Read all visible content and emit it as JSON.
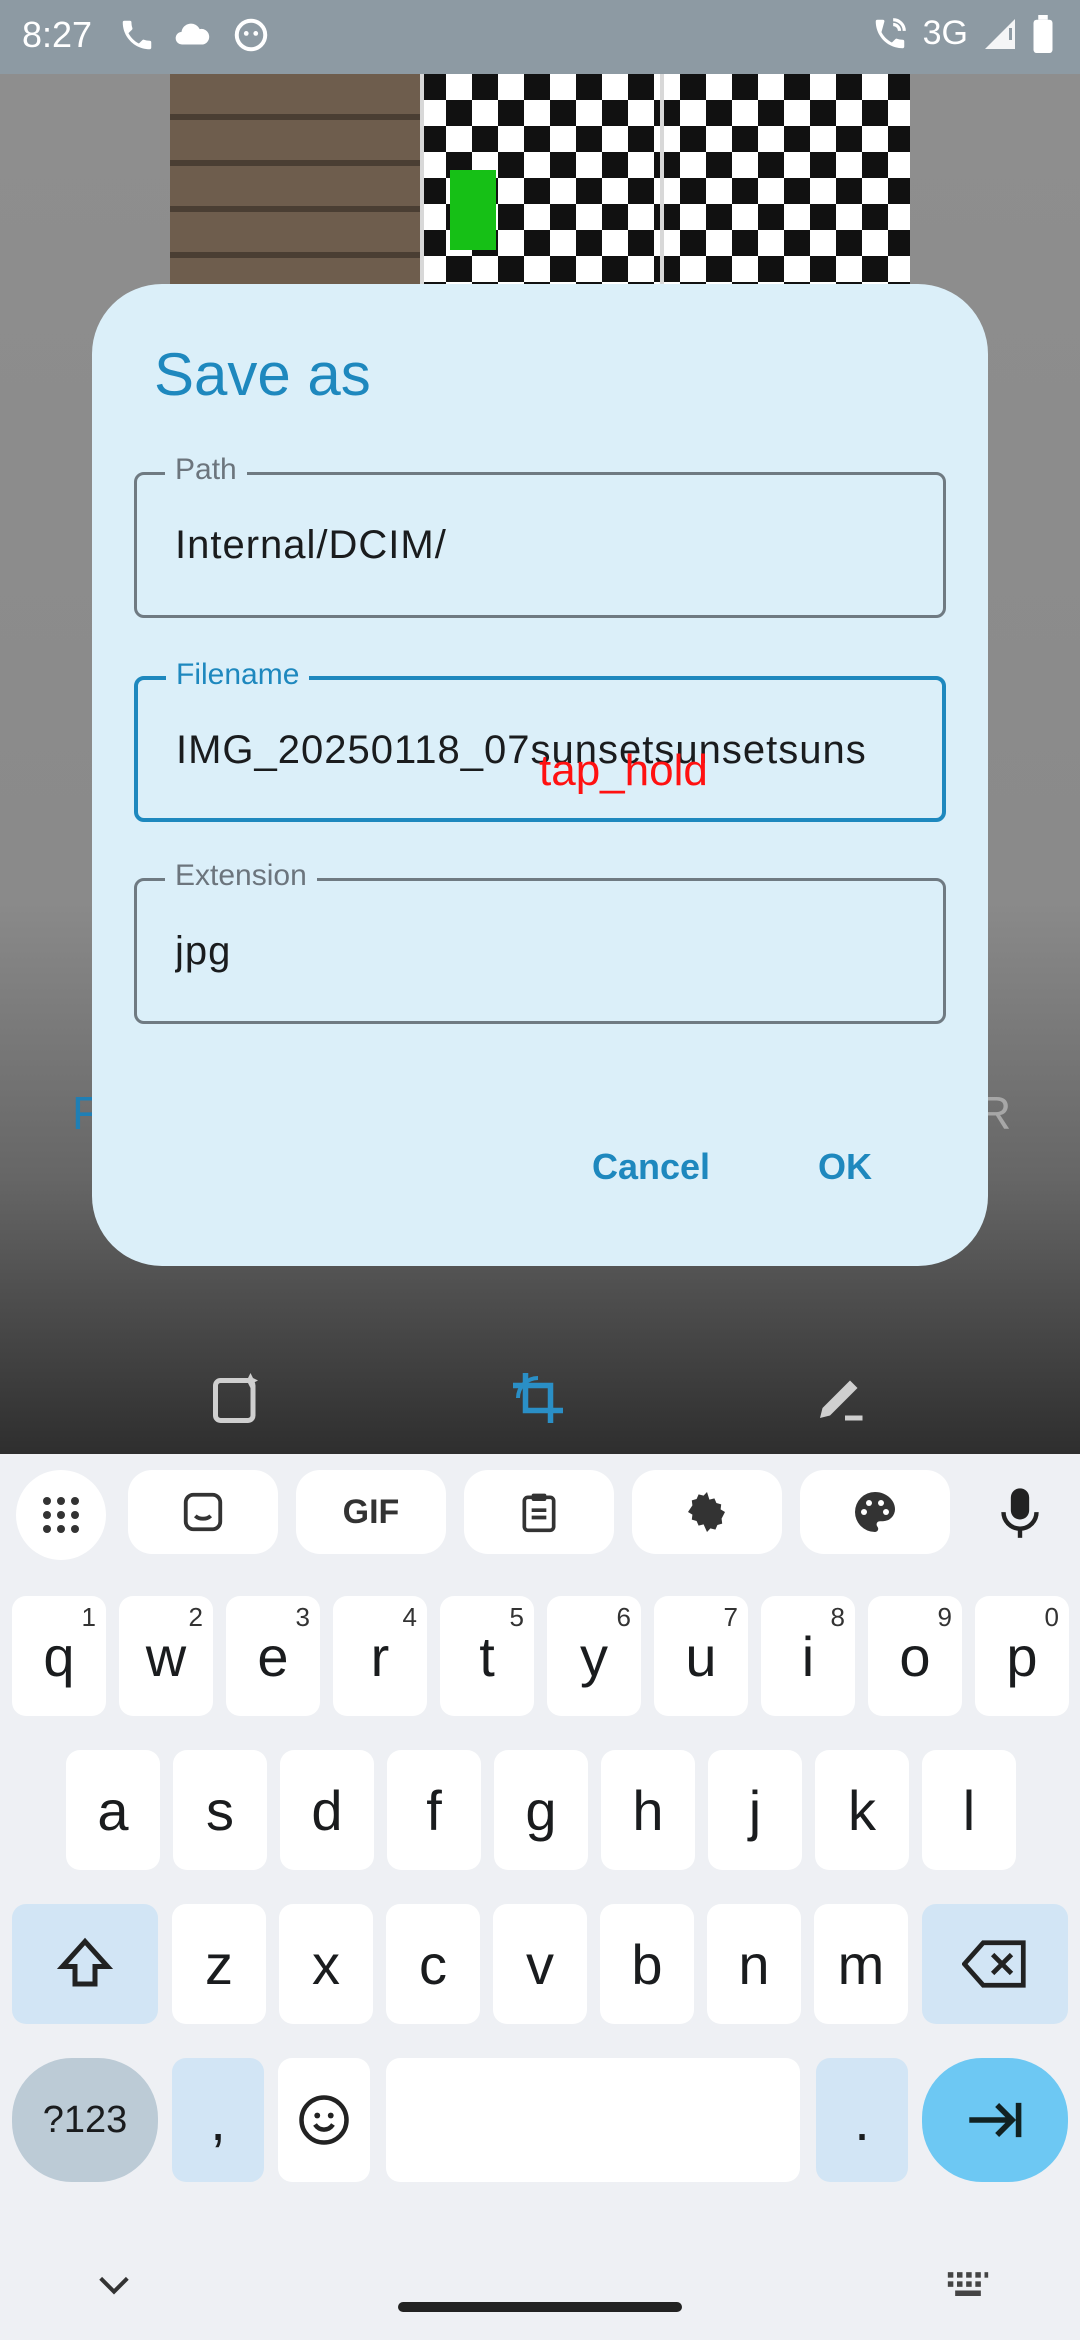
{
  "status_bar": {
    "time": "8:27",
    "network": "3G",
    "icons": [
      "phone-icon",
      "cloud-icon",
      "face-icon",
      "wifi-call-icon",
      "signal-icon",
      "battery-icon"
    ]
  },
  "background": {
    "left_letter": "F",
    "right_letter": "R",
    "tools": [
      "auto-enhance-icon",
      "crop-rotate-icon",
      "edit-icon"
    ]
  },
  "dialog": {
    "title": "Save as",
    "path": {
      "label": "Path",
      "value": "Internal/DCIM/"
    },
    "filename": {
      "label": "Filename",
      "value": "IMG_20250118_07sunsetsunsetsuns"
    },
    "extension": {
      "label": "Extension",
      "value": "jpg"
    },
    "cancel_label": "Cancel",
    "ok_label": "OK"
  },
  "overlay": {
    "action_label": "tap_hold"
  },
  "keyboard": {
    "toolbar": [
      "apps-grid-icon",
      "sticker-icon",
      "GIF",
      "clipboard-icon",
      "settings-icon",
      "palette-icon",
      "mic-icon"
    ],
    "row1": [
      {
        "k": "q",
        "n": "1"
      },
      {
        "k": "w",
        "n": "2"
      },
      {
        "k": "e",
        "n": "3"
      },
      {
        "k": "r",
        "n": "4"
      },
      {
        "k": "t",
        "n": "5"
      },
      {
        "k": "y",
        "n": "6"
      },
      {
        "k": "u",
        "n": "7"
      },
      {
        "k": "i",
        "n": "8"
      },
      {
        "k": "o",
        "n": "9"
      },
      {
        "k": "p",
        "n": "0"
      }
    ],
    "row2": [
      "a",
      "s",
      "d",
      "f",
      "g",
      "h",
      "j",
      "k",
      "l"
    ],
    "row3": [
      "z",
      "x",
      "c",
      "v",
      "b",
      "n",
      "m"
    ],
    "symbols_label": "?123",
    "comma_label": ",",
    "period_label": "."
  },
  "colors": {
    "accent": "#1e88be",
    "dialog_bg": "#dbeff9",
    "overlay_text": "#ff1111",
    "enter_key": "#6dc8f3"
  }
}
